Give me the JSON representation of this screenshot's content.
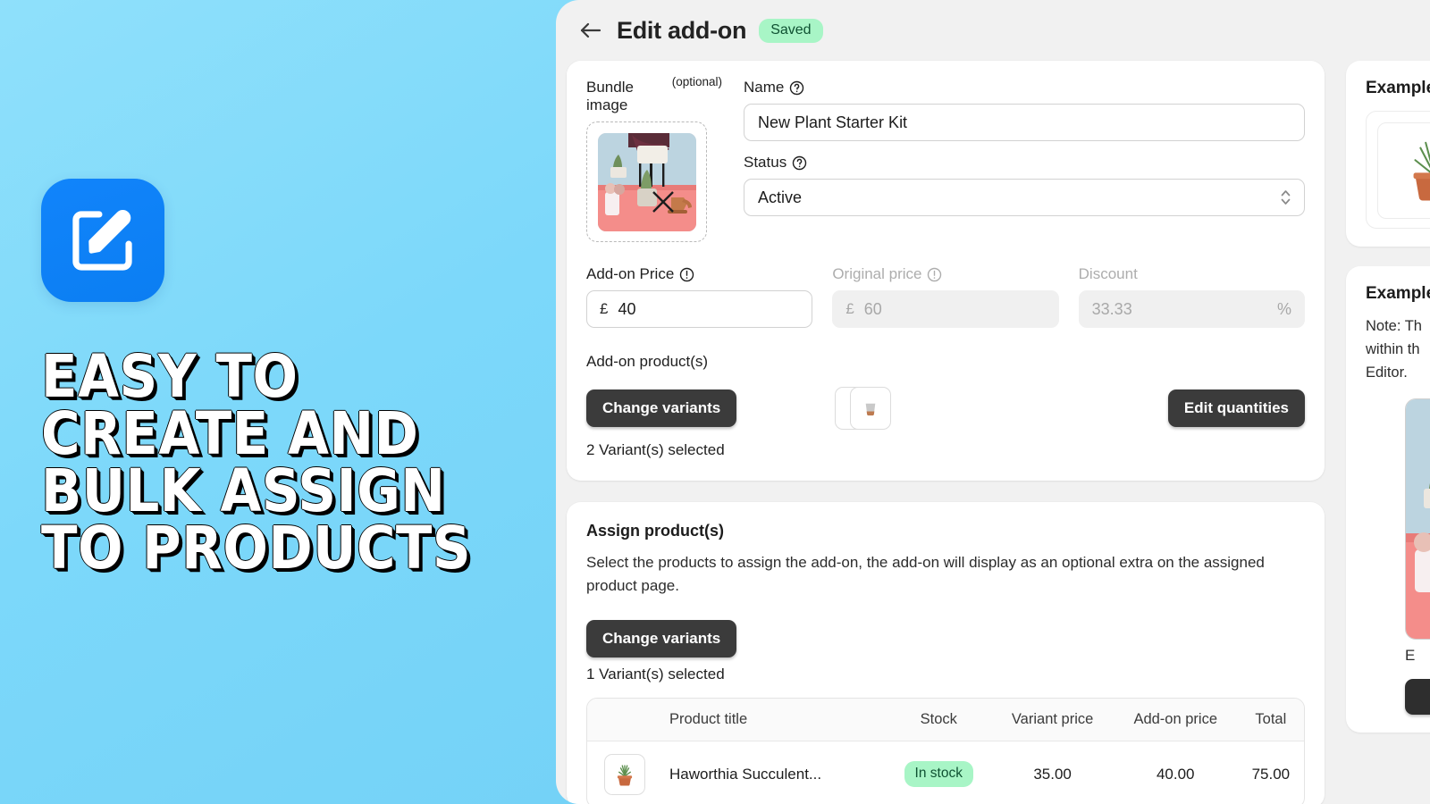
{
  "promo": {
    "app_icon_name": "edit-square-pencil-icon",
    "headline": "EASY TO\nCREATE AND\nBULK ASSIGN\nTO PRODUCTS",
    "background_color": "#7cd8fa",
    "icon_color": "#0b7ef2"
  },
  "header": {
    "back_label": "←",
    "title": "Edit add-on",
    "status_badge": "Saved",
    "badge_bg": "#a8f5c6",
    "badge_fg": "#0f5132"
  },
  "details": {
    "bundle_image_label": "Bundle image",
    "bundle_image_optional": "(optional)",
    "name_label": "Name",
    "name_value": "New Plant Starter Kit",
    "name_placeholder": "Name",
    "status_label": "Status",
    "status_value": "Active",
    "addon_price_label": "Add-on Price",
    "addon_price_currency": "£",
    "addon_price_value": "40",
    "original_price_label": "Original price",
    "original_price_currency": "£",
    "original_price_value": "60",
    "discount_label": "Discount",
    "discount_value": "33.33",
    "discount_suffix": "%",
    "addon_products_label": "Add-on product(s)",
    "change_variants_label": "Change variants",
    "edit_quantities_label": "Edit quantities",
    "variants_selected": "2 Variant(s) selected"
  },
  "assign": {
    "title": "Assign product(s)",
    "description": "Select the products to assign the add-on, the add-on will display as an optional extra on the assigned product page.",
    "change_variants_label": "Change variants",
    "variants_selected": "1 Variant(s) selected",
    "table": {
      "columns": [
        "",
        "Product title",
        "Stock",
        "Variant price",
        "Add-on price",
        "Total"
      ],
      "rows": [
        {
          "thumb": "succulent-pot-thumbnail",
          "title": "Haworthia Succulent...",
          "stock": "In stock",
          "variant_price": "35.00",
          "addon_price": "40.00",
          "total": "75.00"
        }
      ]
    }
  },
  "side_panels": [
    {
      "title": "Example",
      "kind": "preview"
    },
    {
      "title": "Example",
      "kind": "note",
      "note": "Note: Th\nwithin th\nEditor.",
      "caption": "E"
    }
  ]
}
